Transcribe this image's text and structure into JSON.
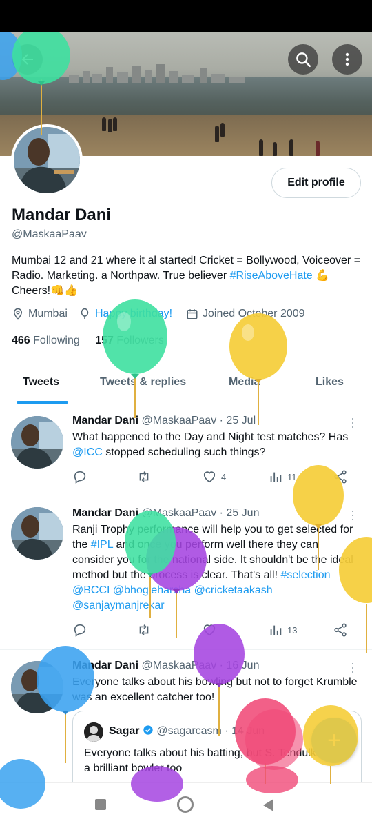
{
  "profile": {
    "name": "Mandar Dani",
    "handle": "@MaskaaPaav",
    "bio_text": "Mumbai 12 and 21 where it al started! Cricket = Bollywood, Voiceover = Radio. Marketing. a Northpaw. True believer ",
    "bio_hashtag": "#RiseAboveHate",
    "bio_end": " 💪 Cheers!👊👍",
    "location": "Mumbai",
    "birthday": "Happy birthday!",
    "joined": "Joined October 2009",
    "following_count": "466",
    "following_label": "Following",
    "followers_count": "157",
    "followers_label": "Followers",
    "edit_label": "Edit profile"
  },
  "tabs": [
    {
      "label": "Tweets",
      "active": true
    },
    {
      "label": "Tweets & replies",
      "active": false
    },
    {
      "label": "Media",
      "active": false
    },
    {
      "label": "Likes",
      "active": false
    }
  ],
  "tweets": [
    {
      "name": "Mandar Dani",
      "handle": "@MaskaaPaav",
      "date": "· 25 Jul",
      "text": "What happened to the Day and Night test matches? Has ",
      "mention": "@ICC",
      "text_end": " stopped scheduling such things?",
      "likes": "4",
      "views": "11"
    },
    {
      "name": "Mandar Dani",
      "handle": "@MaskaaPaav",
      "date": "· 25 Jun",
      "text1": "Ranji Trophy performance will help you to get selected for the ",
      "hashtag1": "#IPL",
      "text2": " and once you perform well there they can consider you for the national side. It shouldn't be the ideal method but the process is clear. That's all! ",
      "hashtag2": "#selection",
      "mentions": "@BCCI @bhogleharsha @cricketaakash @sanjaymanjrekar",
      "views": "13"
    },
    {
      "name": "Mandar Dani",
      "handle": "@MaskaaPaav",
      "date": "· 16 Jun",
      "text": "Everyone talks about his bowling but not to forget Krumble was an excellent catcher too!",
      "quote": {
        "name": "Sagar",
        "handle": "@sagarcasm",
        "date": "· 14 Jun",
        "text": "Everyone talks about his batting, but S. Tendulkar was a brilliant bowler too"
      }
    }
  ],
  "fab_label": "+",
  "colors": {
    "accent": "#1d9bf0",
    "text": "#0f1419",
    "secondary": "#536471",
    "balloon_green": "#3ee0a0",
    "balloon_yellow": "#f5cd38",
    "balloon_purple": "#a544e0",
    "balloon_blue": "#3aa2f0",
    "balloon_pink": "#f04a78"
  }
}
